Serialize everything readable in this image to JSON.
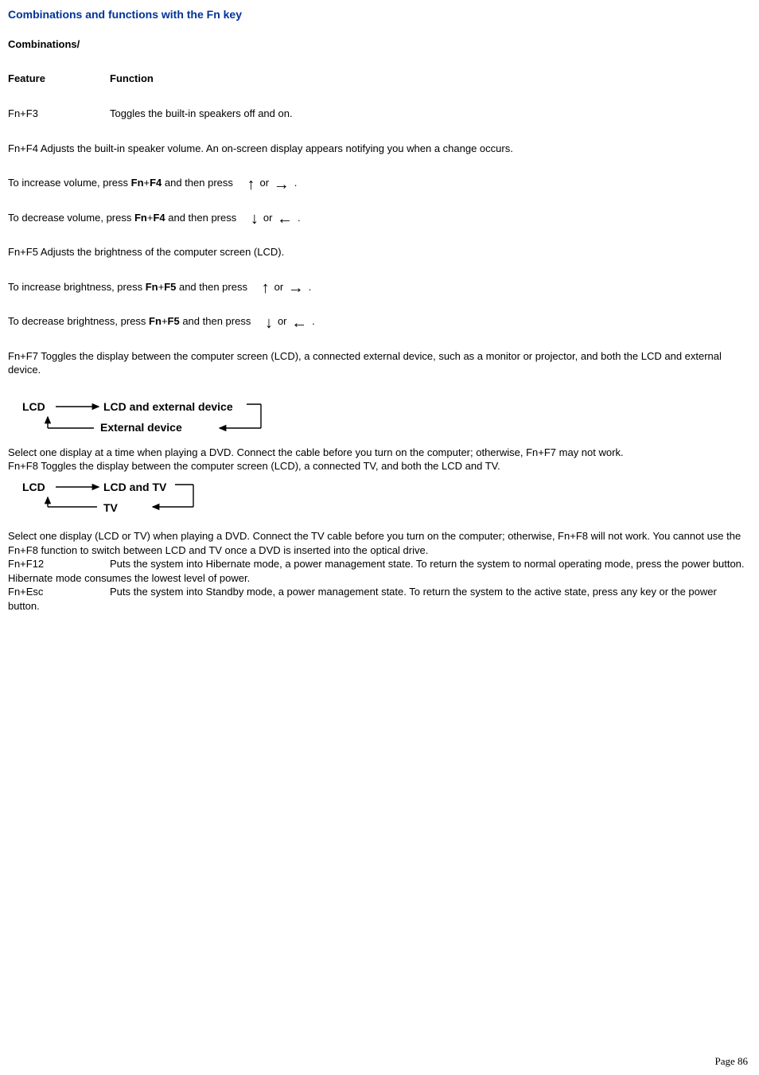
{
  "title": "Combinations and functions with the Fn key",
  "subheader": "Combinations/",
  "colA": "Feature",
  "colB": "Function",
  "f3_key": "Fn+F3",
  "f3_desc": "Toggles the built-in speakers off and on.",
  "f4_line": "Fn+F4  Adjusts the built-in speaker volume. An on-screen display appears notifying you when a change occurs.",
  "vol_inc_a": "To increase volume, press ",
  "fn": "Fn",
  "plus": "+",
  "f4": "F4",
  "then_press": " and then press ",
  "or_word": "or ",
  "period": ".",
  "vol_dec_a": "To decrease volume, press ",
  "f5_line": "Fn+F5  Adjusts the brightness of the computer screen (LCD).",
  "bri_inc_a": "To increase brightness, press ",
  "f5": "F5",
  "bri_dec_a": "To decrease brightness, press ",
  "f7_line": "Fn+F7  Toggles the display between the computer screen (LCD), a connected external device, such as a monitor or projector, and both the LCD and external device.",
  "diag1_lcd": "LCD",
  "diag1_both": "LCD and external device",
  "diag1_ext": "External device",
  "f7_note": "Select one display at a time when playing a DVD. Connect the cable before you turn on the computer; otherwise, Fn+F7 may not work.",
  "f8_line": "Fn+F8  Toggles the display between the computer screen (LCD), a connected TV, and both the LCD and TV.",
  "diag2_lcd": "LCD",
  "diag2_both": "LCD and TV",
  "diag2_tv": "TV",
  "f8_note": "Select one display (LCD or TV) when playing a DVD. Connect the TV cable before you turn on the computer; otherwise, Fn+F8 will not work. You cannot use the Fn+F8 function to switch between LCD and TV once a DVD is inserted into the optical drive.",
  "f12_key": "Fn+F12",
  "f12_desc": "Puts the system into Hibernate mode, a power management state. To return the system to normal operating mode, press the power button. Hibernate mode consumes the lowest level of power.",
  "esc_key": "Fn+Esc",
  "esc_desc": "Puts the system into Standby mode, a power management state. To return the system to the active state, press any key or the power button.",
  "page": "Page  86"
}
